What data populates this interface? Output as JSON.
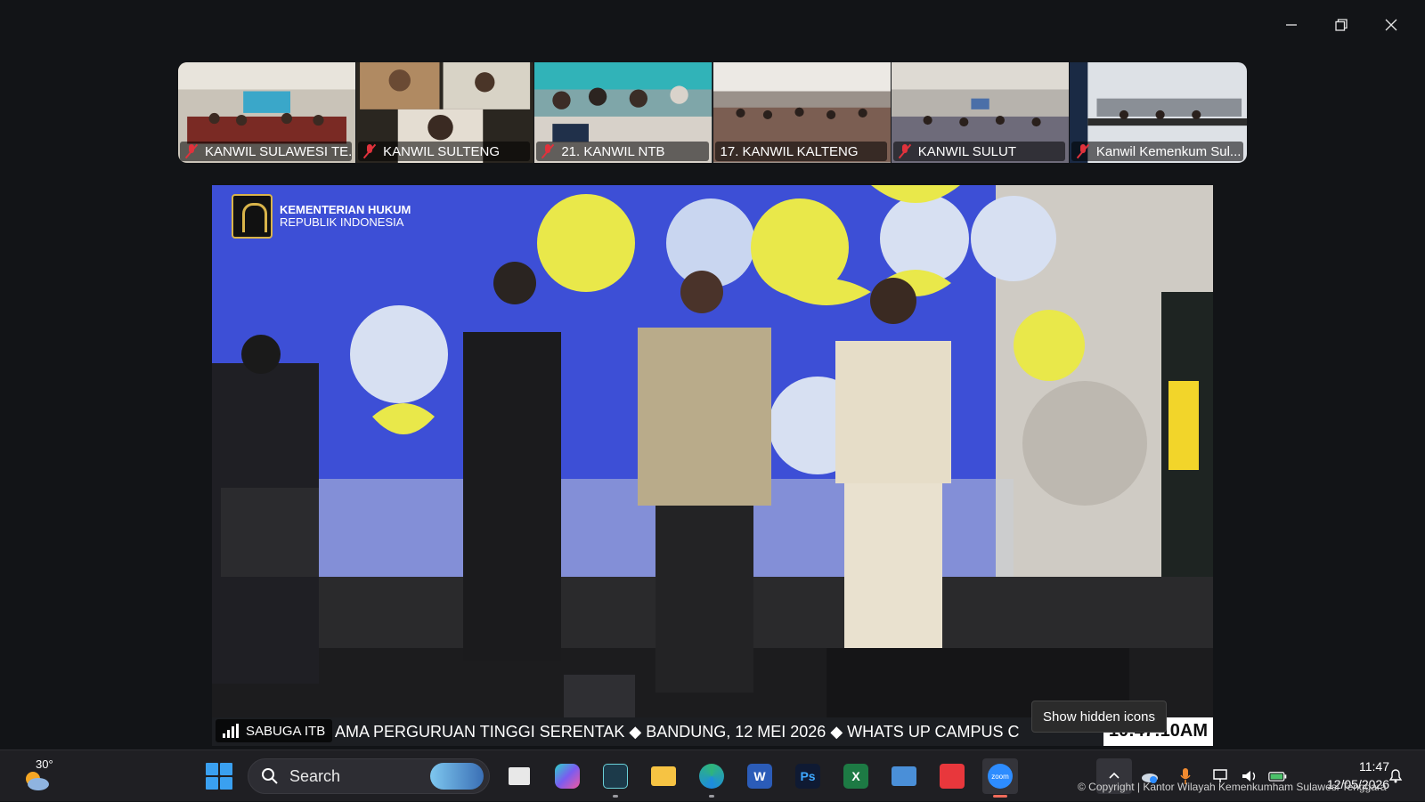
{
  "window": {
    "controls": [
      {
        "name": "minimize-button",
        "glyph": "minimize-icon"
      },
      {
        "name": "restore-button",
        "glyph": "restore-icon"
      },
      {
        "name": "close-button",
        "glyph": "close-icon"
      }
    ]
  },
  "gallery": {
    "participants": [
      {
        "name": "KANWIL SULAWESI TE...",
        "muted": true
      },
      {
        "name": "KANWIL SULTENG",
        "muted": true
      },
      {
        "name": "21. KANWIL NTB",
        "muted": true
      },
      {
        "name": "17. KANWIL KALTENG",
        "muted": false
      },
      {
        "name": "KANWIL SULUT",
        "muted": true
      },
      {
        "name": "Kanwil Kemenkum Sul...",
        "muted": true
      }
    ]
  },
  "main_video": {
    "logo_line1": "KEMENTERIAN HUKUM",
    "logo_line2": "REPUBLIK INDONESIA",
    "speaker": "SABUGA ITB",
    "ticker": "AMA PERGURUAN TINGGI SERENTAK  ◆  BANDUNG, 12 MEI 2026  ◆  WHATS UP CAMPUS C",
    "time": "10:47:10AM"
  },
  "tooltip": "Show hidden icons",
  "taskbar": {
    "weather_temp": "30°",
    "search_placeholder": "Search",
    "apps": [
      {
        "name": "task-view",
        "label": ""
      },
      {
        "name": "copilot",
        "label": ""
      },
      {
        "name": "news-app",
        "label": ""
      },
      {
        "name": "file-explorer",
        "label": ""
      },
      {
        "name": "edge",
        "label": ""
      },
      {
        "name": "word",
        "label": "W"
      },
      {
        "name": "photoshop",
        "label": "Ps"
      },
      {
        "name": "excel",
        "label": "X"
      },
      {
        "name": "remote-desktop",
        "label": ""
      },
      {
        "name": "anydesk",
        "label": ""
      },
      {
        "name": "zoom",
        "label": "zoom"
      }
    ],
    "clock_time": "11:47",
    "clock_date": "12/05/2026"
  },
  "copyright": "© Copyright | Kantor Wilayah Kemenkumham Sulawesi Tenggara",
  "colors": {
    "background": "#121417",
    "mic_off": "#e0323c",
    "zoom_blue": "#2d8cff"
  }
}
